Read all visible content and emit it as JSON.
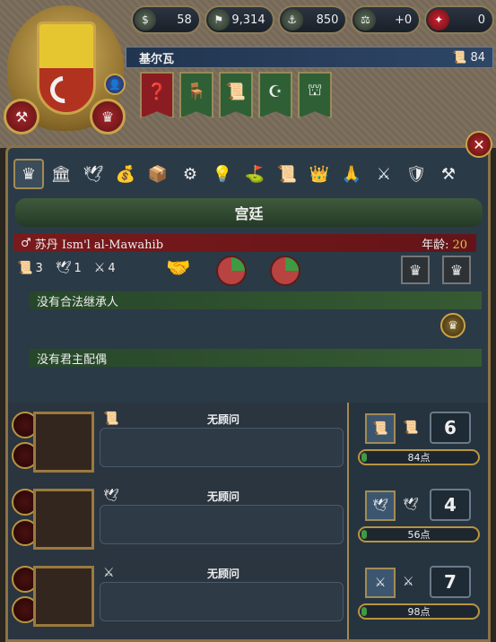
{
  "header": {
    "resources": [
      {
        "name": "treasury",
        "icon": "money-icon",
        "value": "58"
      },
      {
        "name": "manpower",
        "icon": "manpower-icon",
        "value": "9,314"
      },
      {
        "name": "sailors",
        "icon": "sailors-icon",
        "value": "850"
      },
      {
        "name": "stability",
        "icon": "stability-icon",
        "value": "+0"
      },
      {
        "name": "war-exhaustion",
        "icon": "war-icon",
        "value": "0"
      }
    ],
    "country_name": "基尔瓦",
    "edicts_count": "84",
    "banners": [
      {
        "icon": "question-shield-icon",
        "color": "red"
      },
      {
        "icon": "chair-icon",
        "color": "green"
      },
      {
        "icon": "scroll-icon",
        "color": "green"
      },
      {
        "icon": "religion-icon",
        "color": "green"
      },
      {
        "icon": "cannon-icon",
        "color": "green"
      }
    ],
    "flag_colors": [
      "#e6c630",
      "#b23220"
    ]
  },
  "tabs": [
    "court",
    "government",
    "diplomacy",
    "economy",
    "trade",
    "technology",
    "ideas",
    "military",
    "missions",
    "estates",
    "religion",
    "mercenaries",
    "decisions",
    "subjects"
  ],
  "court": {
    "title": "宫廷",
    "ruler_label": "苏丹 Ism'l al-Mawahib",
    "age_label": "年龄:",
    "age_value": "20",
    "adm": "3",
    "dip": "1",
    "mil": "4",
    "heir_text": "没有合法继承人",
    "consort_text": "没有君主配偶"
  },
  "advisors": [
    {
      "icon": "scroll-icon",
      "name": "无顾问"
    },
    {
      "icon": "dove-icon",
      "name": "无顾问"
    },
    {
      "icon": "swords-icon",
      "name": "无顾问"
    }
  ],
  "monarch_power": [
    {
      "icon": "scroll-icon",
      "value": "6",
      "points": "84点"
    },
    {
      "icon": "dove-icon",
      "value": "4",
      "points": "56点"
    },
    {
      "icon": "swords-icon",
      "value": "7",
      "points": "98点"
    }
  ]
}
